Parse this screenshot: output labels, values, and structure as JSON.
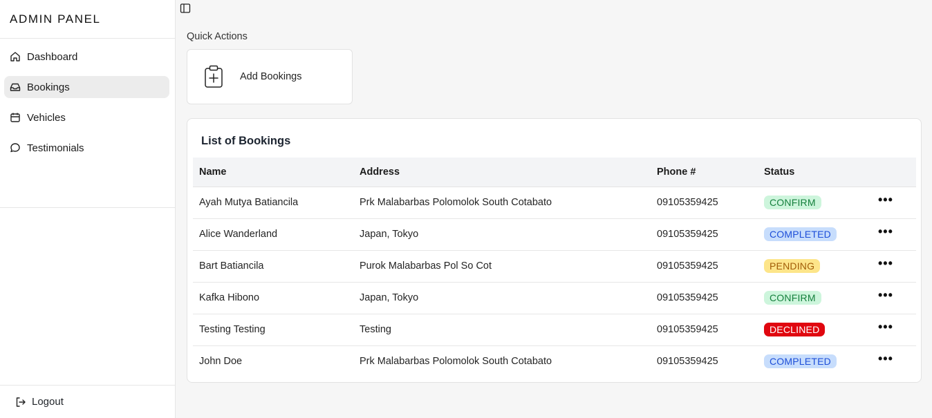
{
  "sidebar": {
    "brand": "ADMIN PANEL",
    "items": [
      {
        "label": "Dashboard",
        "icon": "home-icon"
      },
      {
        "label": "Bookings",
        "icon": "inbox-icon",
        "active": true
      },
      {
        "label": "Vehicles",
        "icon": "calendar-icon"
      },
      {
        "label": "Testimonials",
        "icon": "message-icon"
      }
    ],
    "logout": "Logout"
  },
  "quick_actions": {
    "label": "Quick Actions",
    "add_bookings": "Add Bookings"
  },
  "bookings": {
    "title": "List of Bookings",
    "columns": [
      "Name",
      "Address",
      "Phone #",
      "Status"
    ],
    "rows": [
      {
        "name": "Ayah Mutya Batiancila",
        "address": "Prk Malabarbas Polomolok South Cotabato",
        "phone": "09105359425",
        "status": "CONFIRM",
        "status_key": "confirm"
      },
      {
        "name": "Alice Wanderland",
        "address": "Japan, Tokyo",
        "phone": "09105359425",
        "status": "COMPLETED",
        "status_key": "completed"
      },
      {
        "name": "Bart Batiancila",
        "address": "Purok Malabarbas Pol So Cot",
        "phone": "09105359425",
        "status": "PENDING",
        "status_key": "pending"
      },
      {
        "name": "Kafka Hibono",
        "address": "Japan, Tokyo",
        "phone": "09105359425",
        "status": "CONFIRM",
        "status_key": "confirm"
      },
      {
        "name": "Testing Testing",
        "address": "Testing",
        "phone": "09105359425",
        "status": "DECLINED",
        "status_key": "declined"
      },
      {
        "name": "John Doe",
        "address": "Prk Malabarbas Polomolok South Cotabato",
        "phone": "09105359425",
        "status": "COMPLETED",
        "status_key": "completed"
      }
    ],
    "row_action": "•••"
  },
  "colors": {
    "confirm_bg": "#cdf5dc",
    "completed_bg": "#c7ddfc",
    "pending_bg": "#fde58a",
    "declined_bg": "#e0070f",
    "active_nav_bg": "#ececec"
  }
}
